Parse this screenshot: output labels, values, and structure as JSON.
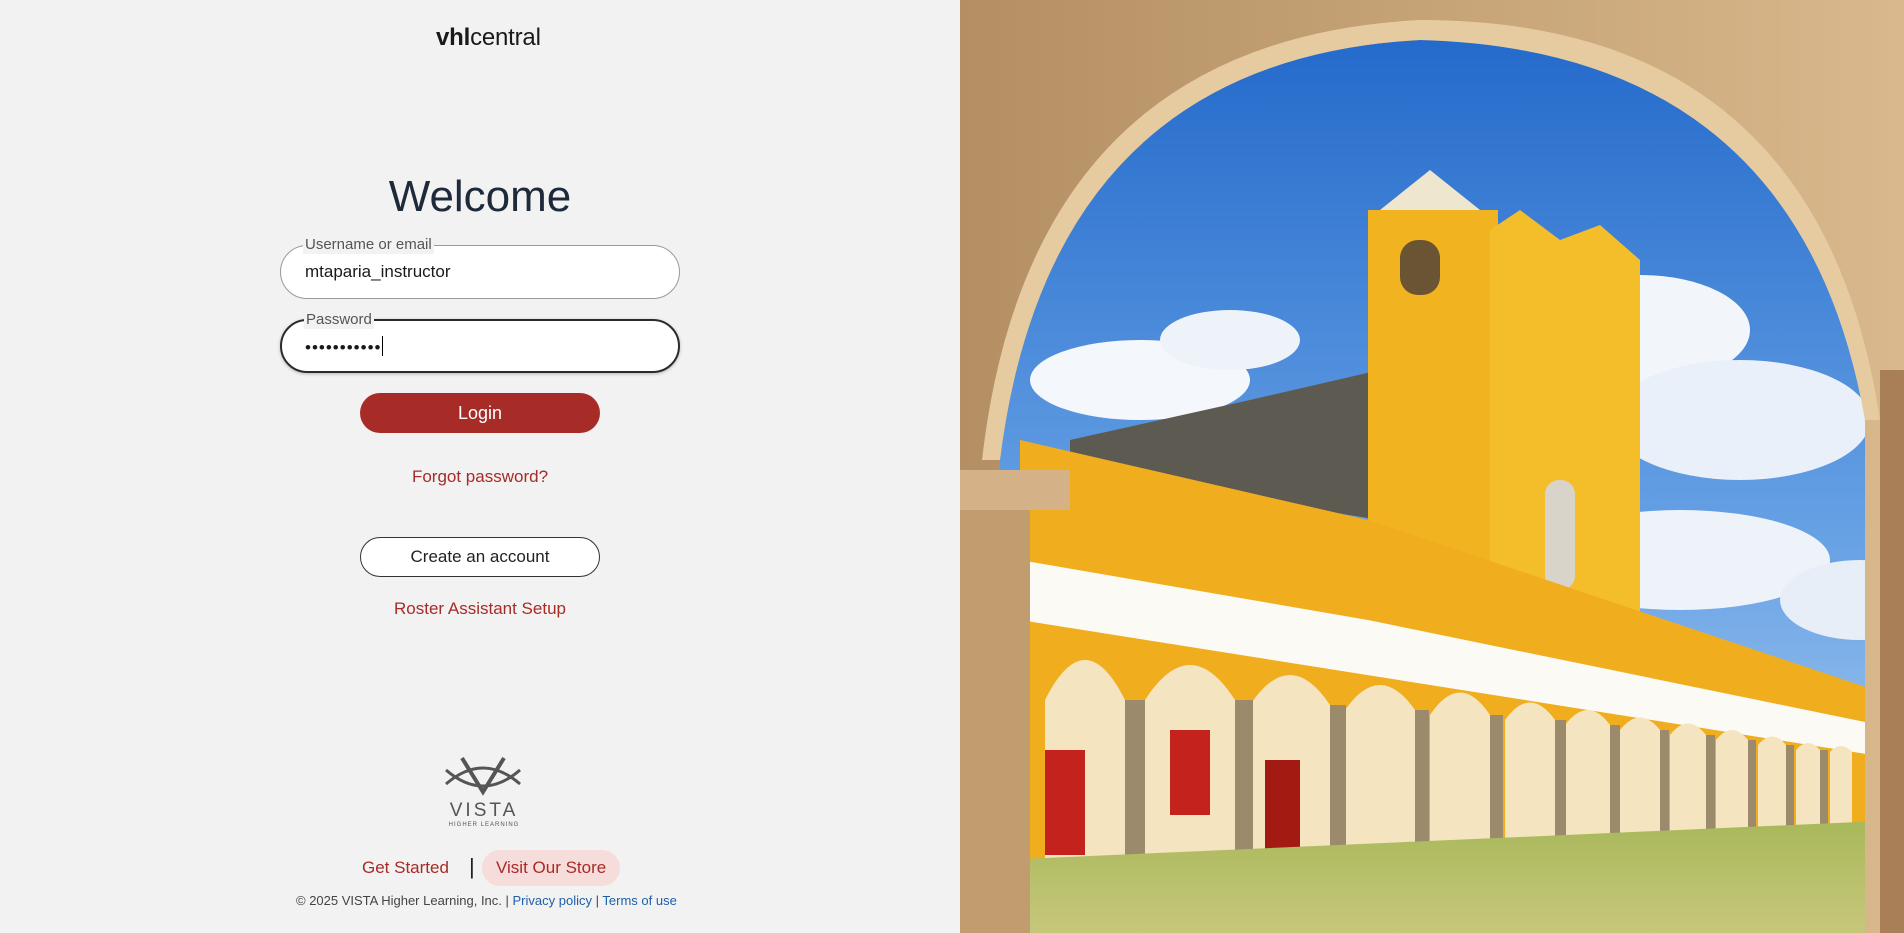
{
  "brand": {
    "logo_bold": "vhl",
    "logo_light": "central"
  },
  "login": {
    "title": "Welcome",
    "username_label": "Username or email",
    "username_value": "mtaparia_instructor",
    "password_label": "Password",
    "password_value": "•••••••••••",
    "login_button": "Login",
    "forgot_link": "Forgot password?",
    "create_account_button": "Create an account",
    "roster_link": "Roster Assistant Setup"
  },
  "vista": {
    "wordmark": "VISTA",
    "subtitle": "HIGHER LEARNING"
  },
  "footer": {
    "get_started": "Get Started",
    "separator": "|",
    "store": "Visit Our Store",
    "copyright": "© 2025 VISTA Higher Learning, Inc. |",
    "privacy": "Privacy policy",
    "pipe": "|",
    "terms": "Terms of use"
  },
  "colors": {
    "accent": "#a72b27",
    "background": "#f2f2f2",
    "link_blue": "#1f5fa8",
    "store_bg": "#f6dcda"
  },
  "image": {
    "subject": "yellow-convent-arch-photo"
  }
}
